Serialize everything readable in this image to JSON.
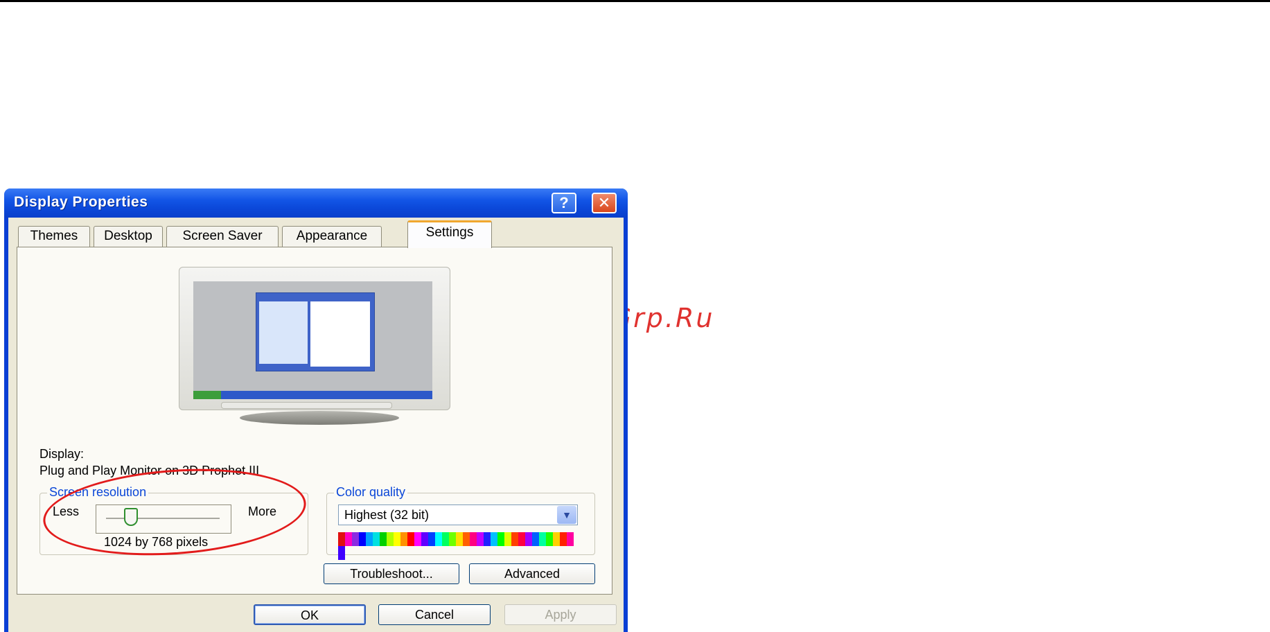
{
  "watermark": "McGrp.Ru",
  "window": {
    "title": "Display Properties",
    "help_label": "?",
    "close_label": "✕"
  },
  "tabs": [
    {
      "label": "Themes"
    },
    {
      "label": "Desktop"
    },
    {
      "label": "Screen Saver"
    },
    {
      "label": "Appearance"
    },
    {
      "label": "Settings",
      "active": true
    }
  ],
  "display": {
    "caption": "Display:",
    "monitor_name": "Plug and Play Monitor on 3D Prophet III"
  },
  "screen_resolution": {
    "title": "Screen resolution",
    "less_label": "Less",
    "more_label": "More",
    "value_text": "1024 by 768 pixels",
    "slider_fraction": 0.16
  },
  "color_quality": {
    "title": "Color quality",
    "selected": "Highest (32 bit)",
    "dropdown_icon": "chevron-down-icon"
  },
  "buttons": {
    "troubleshoot": "Troubleshoot...",
    "advanced": "Advanced",
    "ok": "OK",
    "cancel": "Cancel",
    "apply": "Apply"
  },
  "colors": {
    "title_bar": "#0b47d8",
    "active_tab_accent": "#f0a72f",
    "highlight_ellipse": "#e21b1b",
    "group_title_blue": "#0a46d8"
  }
}
